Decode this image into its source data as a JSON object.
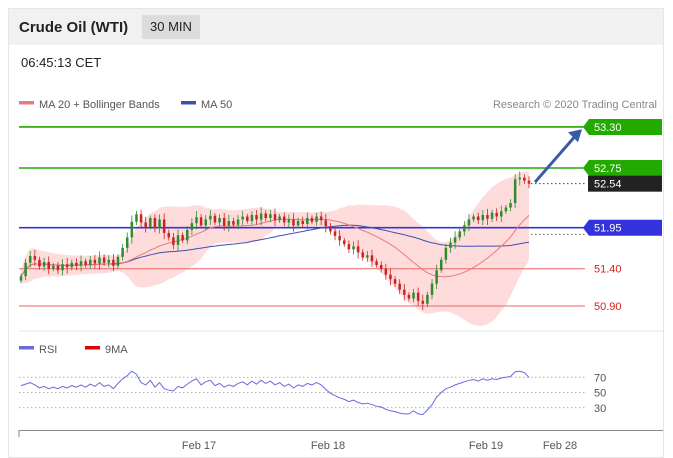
{
  "header": {
    "title": "Crude Oil (WTI)",
    "timeframe": "30 MIN"
  },
  "clock": "06:45:13 CET",
  "legend": {
    "ma20": {
      "label": "MA 20 + Bollinger Bands",
      "color": "#e87b7b"
    },
    "ma50": {
      "label": "MA 50",
      "color": "#3f4fae"
    },
    "credit": "Research © 2020 Trading Central"
  },
  "rsi_legend": {
    "rsi": {
      "label": "RSI",
      "color": "#6b6bdc"
    },
    "ma9": {
      "label": "9MA",
      "color": "#e00000"
    }
  },
  "colors": {
    "up": "#2e8b2e",
    "down": "#cc2222",
    "green": "#22aa00",
    "blue": "#3333dd",
    "red": "#ee6666",
    "band": "#ffd0d0"
  },
  "chart_data": {
    "type": "candlestick",
    "ylim": [
      50.78,
      53.38
    ],
    "x_ticks": [
      "Feb 17",
      "Feb 18",
      "Feb 19",
      "Feb 28"
    ],
    "levels": [
      {
        "value": 53.3,
        "label": "53.30",
        "kind": "green"
      },
      {
        "value": 52.75,
        "label": "52.75",
        "kind": "green"
      },
      {
        "value": 52.54,
        "label": "52.54",
        "kind": "last"
      },
      {
        "value": 51.95,
        "label": "51.95",
        "kind": "blue"
      },
      {
        "value": 51.4,
        "label": "51.40",
        "kind": "red"
      },
      {
        "value": 50.9,
        "label": "50.90",
        "kind": "red"
      }
    ],
    "closes": [
      51.3,
      51.48,
      51.57,
      51.52,
      51.43,
      51.49,
      51.4,
      51.44,
      51.38,
      51.46,
      51.42,
      51.48,
      51.44,
      51.5,
      51.45,
      51.52,
      51.47,
      51.55,
      51.48,
      51.52,
      51.44,
      51.56,
      51.68,
      51.82,
      52.03,
      52.13,
      52.02,
      51.96,
      52.08,
      51.94,
      52.06,
      51.88,
      51.82,
      51.72,
      51.85,
      51.78,
      51.92,
      52.01,
      52.09,
      51.98,
      52.06,
      52.11,
      52.02,
      52.08,
      51.98,
      52.04,
      51.99,
      52.06,
      52.1,
      52.04,
      52.12,
      52.06,
      52.14,
      52.08,
      52.13,
      52.05,
      52.1,
      52.02,
      52.06,
      51.98,
      52.04,
      52.0,
      52.08,
      52.03,
      52.1,
      52.05,
      51.97,
      51.9,
      51.84,
      51.78,
      51.73,
      51.66,
      51.7,
      51.62,
      51.55,
      51.58,
      51.5,
      51.45,
      51.4,
      51.32,
      51.26,
      51.2,
      51.12,
      51.05,
      51.0,
      51.08,
      50.97,
      50.93,
      51.05,
      51.2,
      51.38,
      51.52,
      51.68,
      51.75,
      51.82,
      51.9,
      51.98,
      52.06,
      52.1,
      52.05,
      52.12,
      52.07,
      52.15,
      52.1,
      52.17,
      52.22,
      52.28,
      52.6,
      52.62,
      52.58,
      52.54
    ],
    "rsi": [
      59,
      61,
      63,
      60,
      56,
      58,
      55,
      57,
      55,
      58,
      56,
      59,
      57,
      60,
      57,
      61,
      58,
      63,
      58,
      60,
      55,
      62,
      68,
      72,
      78,
      74,
      63,
      60,
      66,
      57,
      63,
      55,
      53,
      52,
      58,
      56,
      61,
      65,
      68,
      60,
      64,
      66,
      59,
      62,
      57,
      60,
      58,
      62,
      64,
      60,
      65,
      61,
      66,
      62,
      65,
      60,
      63,
      58,
      61,
      56,
      60,
      58,
      62,
      60,
      63,
      60,
      54,
      49,
      46,
      43,
      41,
      38,
      40,
      37,
      35,
      36,
      34,
      32,
      31,
      28,
      26,
      25,
      23,
      22,
      22,
      26,
      22,
      21,
      27,
      34,
      44,
      50,
      55,
      57,
      60,
      62,
      64,
      66,
      67,
      65,
      68,
      66,
      68,
      67,
      69,
      70,
      71,
      77,
      78,
      76,
      70
    ],
    "rsi_ticks": [
      70,
      50,
      30
    ]
  }
}
